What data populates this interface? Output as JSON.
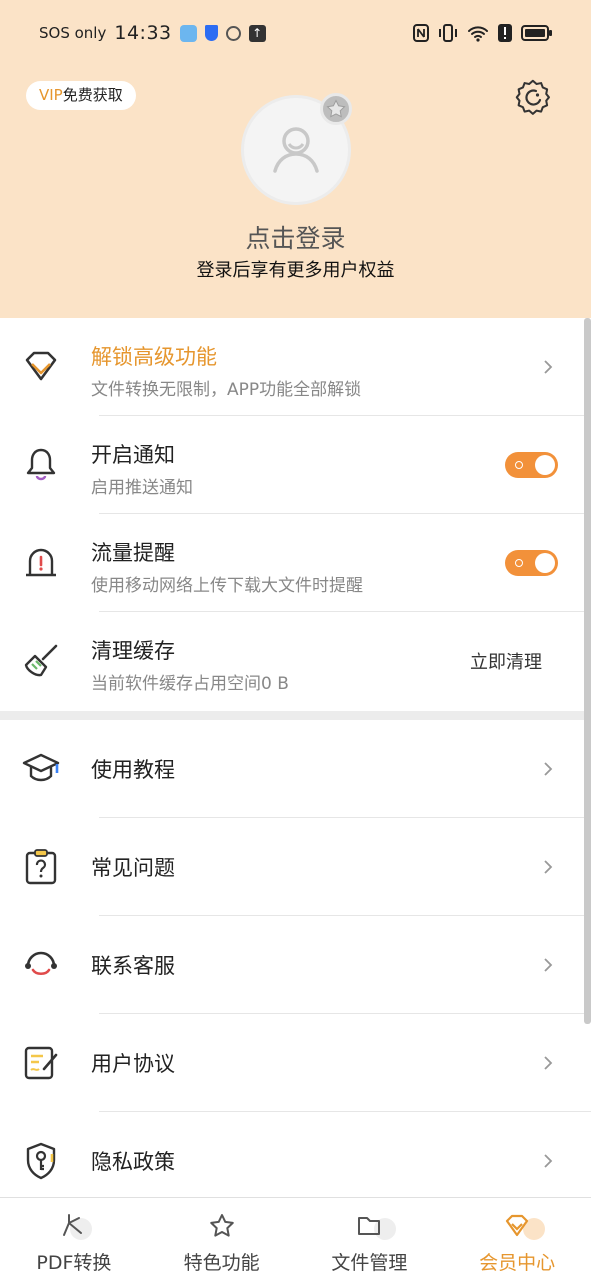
{
  "status_bar": {
    "carrier": "SOS only",
    "time": "14:33",
    "battery_icon": "battery-icon",
    "wifi_icon": "wifi-icon"
  },
  "header": {
    "vip_prefix": "VIP",
    "vip_suffix": "免费获取",
    "login_title": "点击登录",
    "login_subtitle": "登录后享有更多用户权益",
    "background_color": "#fbe3c7"
  },
  "settings": [
    {
      "title": "解锁高级功能",
      "subtitle": "文件转换无限制，APP功能全部解锁",
      "icon": "diamond-icon"
    },
    {
      "title": "开启通知",
      "subtitle": "启用推送通知",
      "icon": "bell-icon",
      "toggle_on": true
    },
    {
      "title": "流量提醒",
      "subtitle": "使用移动网络上传下载大文件时提醒",
      "icon": "alert-icon",
      "toggle_on": true
    },
    {
      "title": "清理缓存",
      "subtitle": "当前软件缓存占用空间0 B",
      "icon": "broom-icon",
      "action_label": "立即清理"
    }
  ],
  "menu": [
    {
      "title": "使用教程",
      "icon": "graduation-cap-icon"
    },
    {
      "title": "常见问题",
      "icon": "question-clipboard-icon"
    },
    {
      "title": "联系客服",
      "icon": "headset-icon"
    },
    {
      "title": "用户协议",
      "icon": "document-edit-icon"
    },
    {
      "title": "隐私政策",
      "icon": "shield-key-icon"
    }
  ],
  "bottom_nav": [
    {
      "label": "PDF转换",
      "icon": "convert-icon",
      "active": false
    },
    {
      "label": "特色功能",
      "icon": "star-icon",
      "active": false
    },
    {
      "label": "文件管理",
      "icon": "folder-icon",
      "active": false
    },
    {
      "label": "会员中心",
      "icon": "member-diamond-icon",
      "active": true
    }
  ],
  "colors": {
    "accent": "#e6962e",
    "toggle": "#f2913a"
  }
}
